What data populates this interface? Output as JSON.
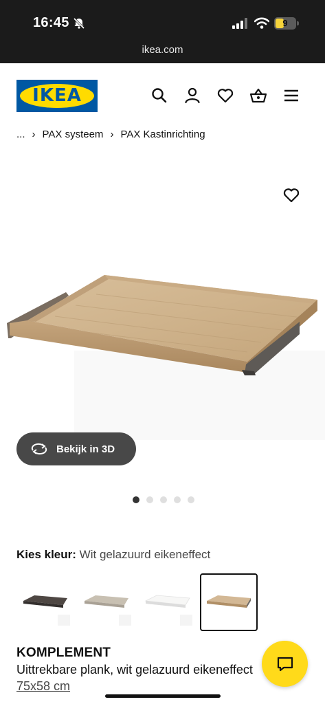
{
  "status_bar": {
    "time": "16:45",
    "battery": "9"
  },
  "browser": {
    "url": "ikea.com"
  },
  "header": {
    "logo_text": "IKEA",
    "icons": [
      "search-icon",
      "account-icon",
      "heart-icon",
      "basket-icon",
      "menu-icon"
    ]
  },
  "breadcrumb": {
    "ellipsis": "...",
    "items": [
      "PAX systeem",
      "PAX Kastinrichting"
    ]
  },
  "gallery": {
    "view_3d_label": "Bekijk in 3D",
    "dot_count": 5,
    "active_dot": 1
  },
  "color_select": {
    "label": "Kies kleur:",
    "value": "Wit gelazuurd eikeneffect",
    "swatches": [
      "zwartbruin",
      "beige",
      "wit",
      "wit gelazuurd eikeneffect"
    ],
    "selected_index": 3
  },
  "product": {
    "name": "KOMPLEMENT",
    "description": "Uittrekbare plank, wit gelazuurd eikeneffect",
    "size": "75x58 cm"
  },
  "colors": {
    "ikea_blue": "#0058a3",
    "ikea_yellow": "#ffdb00",
    "chat_yellow": "#ffda1a"
  }
}
